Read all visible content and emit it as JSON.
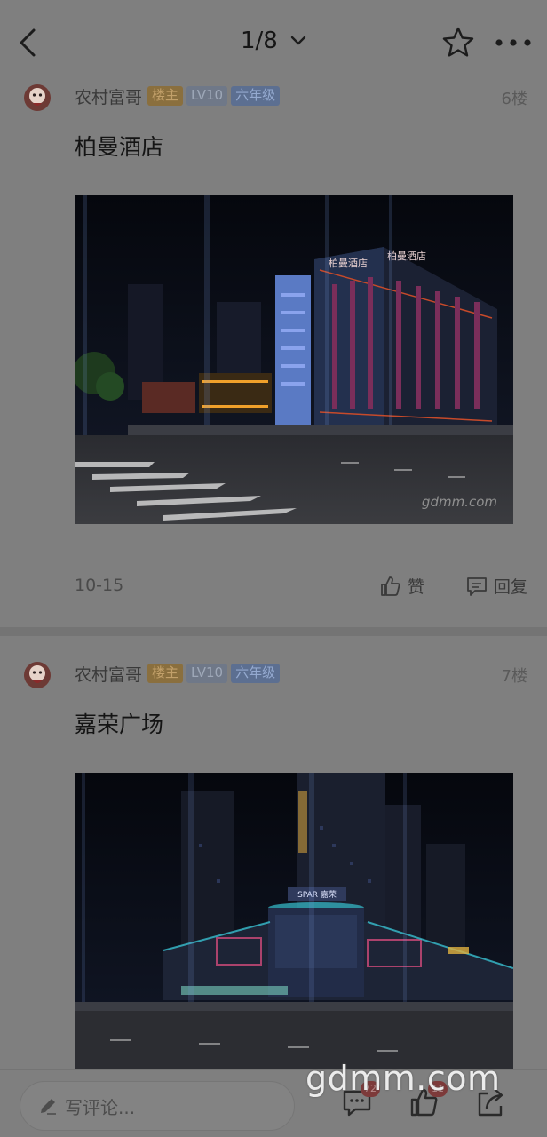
{
  "header": {
    "pager": "1/8",
    "icons": {
      "back": "back-arrow-icon",
      "chevron": "chevron-down-icon",
      "favorite": "star-icon",
      "more": "more-dots-icon"
    }
  },
  "posts": [
    {
      "author": "农村富哥",
      "badges": {
        "host": "楼主",
        "level": "LV10",
        "grade": "六年级"
      },
      "floor": "6楼",
      "title": "柏曼酒店",
      "image": {
        "description_signs": [
          "柏曼酒店",
          "柏曼酒店"
        ],
        "watermark": "gdmm.com"
      },
      "date": "10-15",
      "like_label": "赞",
      "reply_label": "回复"
    },
    {
      "author": "农村富哥",
      "badges": {
        "host": "楼主",
        "level": "LV10",
        "grade": "六年级"
      },
      "floor": "7楼",
      "title": "嘉荣广场",
      "image": {
        "sign": "SPAR 嘉荣"
      }
    }
  ],
  "bottom_bar": {
    "comment_placeholder": "写评论...",
    "comment_count": "72",
    "like_count": "11"
  },
  "overlay_watermark": "gdmm.com",
  "colors": {
    "background": "#7f7f7f",
    "host_badge": "#8a6f3e",
    "level_badge": "#6f7888",
    "grade_badge": "#5c6f91"
  }
}
